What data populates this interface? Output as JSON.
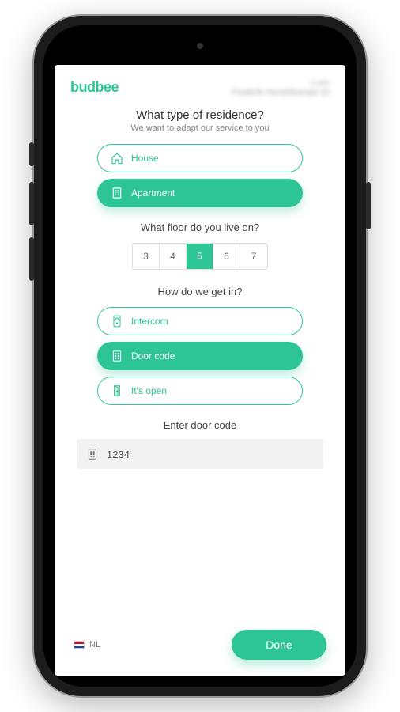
{
  "brand": "budbee",
  "header_meta": {
    "line1": "Code",
    "line2": "Frederik Hendrikstraat 10"
  },
  "residence": {
    "title": "What type of residence?",
    "subtitle": "We want to adapt our service to you",
    "options": [
      {
        "id": "house",
        "label": "House",
        "icon": "house-icon",
        "selected": false
      },
      {
        "id": "apartment",
        "label": "Apartment",
        "icon": "apartment-icon",
        "selected": true
      }
    ]
  },
  "floor": {
    "title": "What floor do you live on?",
    "options": [
      "3",
      "4",
      "5",
      "6",
      "7"
    ],
    "selected": "5"
  },
  "access": {
    "title": "How do we get in?",
    "options": [
      {
        "id": "intercom",
        "label": "Intercom",
        "icon": "intercom-icon",
        "selected": false
      },
      {
        "id": "doorcode",
        "label": "Door code",
        "icon": "keypad-icon",
        "selected": true
      },
      {
        "id": "open",
        "label": "It's open",
        "icon": "door-open-icon",
        "selected": false
      }
    ]
  },
  "doorcode": {
    "label": "Enter door code",
    "value": "1234",
    "icon": "keypad-icon"
  },
  "footer": {
    "lang_label": "NL",
    "done_label": "Done"
  },
  "colors": {
    "accent": "#2dc596"
  }
}
